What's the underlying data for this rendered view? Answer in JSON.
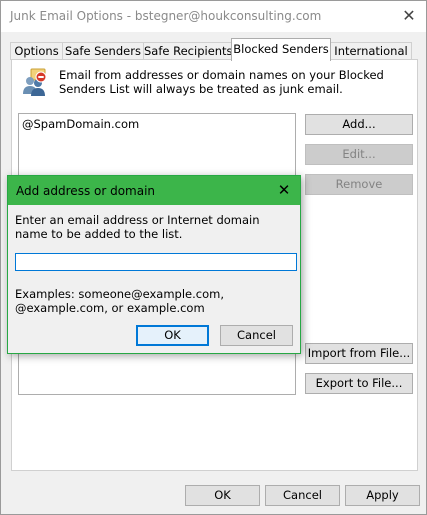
{
  "window": {
    "title": "Junk Email Options - bstegner@houkconsulting.com",
    "close_glyph": "✕"
  },
  "tabs": [
    {
      "label": "Options",
      "active": false
    },
    {
      "label": "Safe Senders",
      "active": false
    },
    {
      "label": "Safe Recipients",
      "active": false
    },
    {
      "label": "Blocked Senders",
      "active": true
    },
    {
      "label": "International",
      "active": false
    }
  ],
  "blocked_senders": {
    "info_icon": "blocked-senders-people-icon",
    "info_text": "Email from addresses or domain names on your Blocked Senders List will always be treated as junk email.",
    "list_items": [
      "@SpamDomain.com"
    ],
    "buttons": {
      "add": "Add...",
      "edit": "Edit...",
      "remove": "Remove",
      "import": "Import from File...",
      "export": "Export to File..."
    }
  },
  "footer": {
    "ok": "OK",
    "cancel": "Cancel",
    "apply": "Apply"
  },
  "dialog": {
    "title": "Add address or domain",
    "close_glyph": "✕",
    "prompt": "Enter an email address or Internet domain name to be added to the list.",
    "input_value": "",
    "examples": "Examples: someone@example.com, @example.com, or example.com",
    "ok": "OK",
    "cancel": "Cancel"
  },
  "colors": {
    "dialog_title_bar": "#3cb54a",
    "focus_accent": "#0078d7"
  }
}
